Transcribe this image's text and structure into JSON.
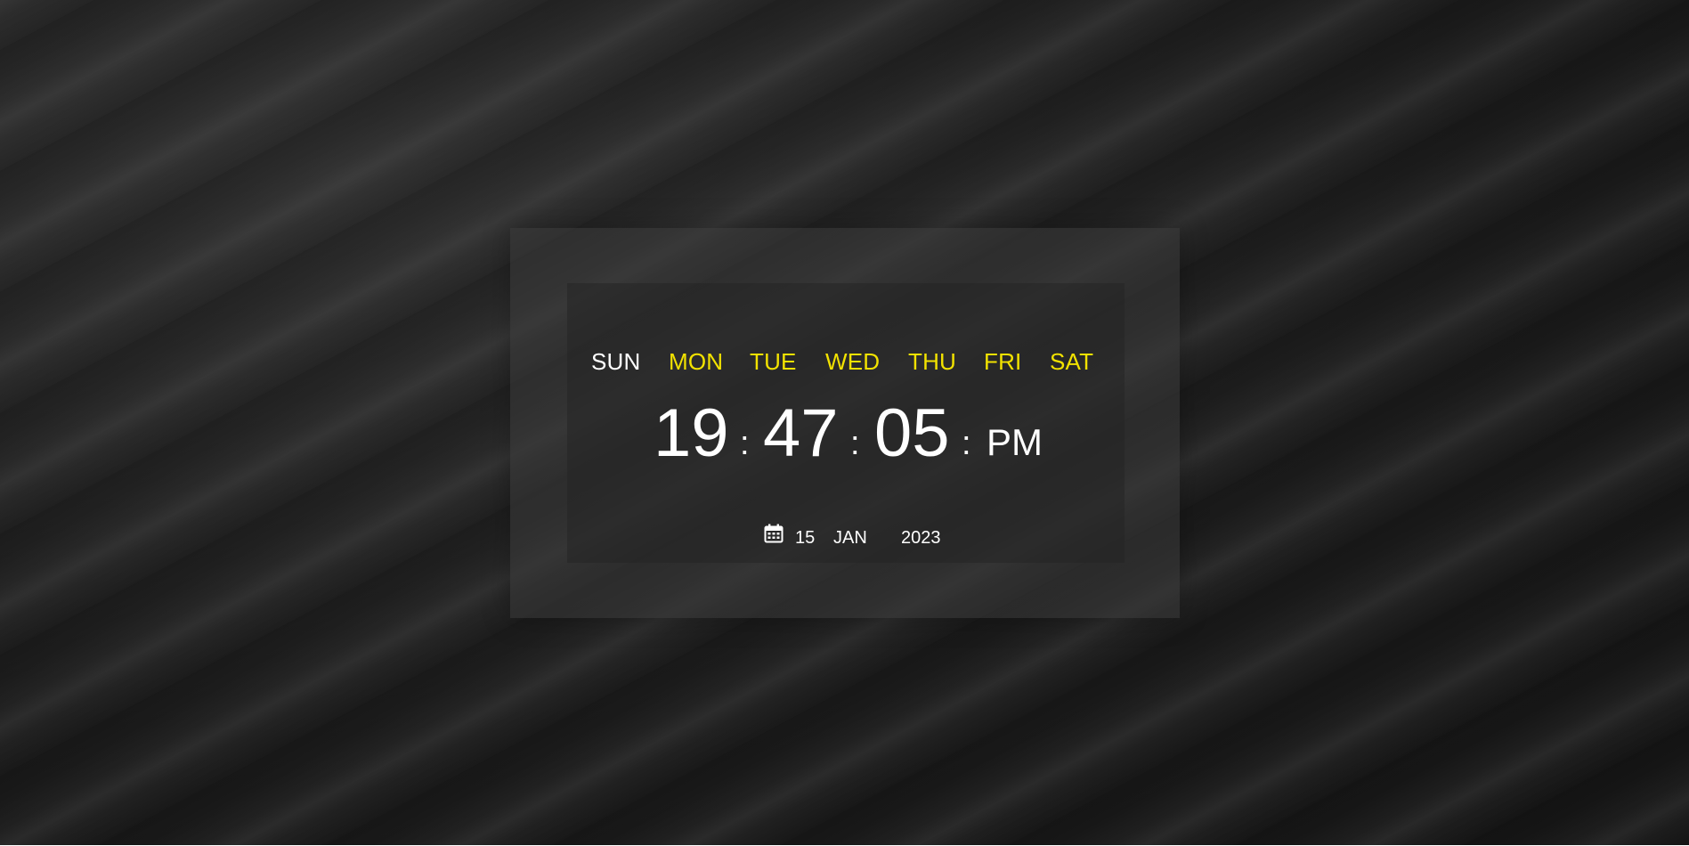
{
  "days": [
    {
      "label": "SUN",
      "active": true
    },
    {
      "label": "MON",
      "active": false
    },
    {
      "label": "TUE",
      "active": false
    },
    {
      "label": "WED",
      "active": false
    },
    {
      "label": "THU",
      "active": false
    },
    {
      "label": "FRI",
      "active": false
    },
    {
      "label": "SAT",
      "active": false
    }
  ],
  "time": {
    "hours": "19",
    "minutes": "47",
    "seconds": "05",
    "separator": ":",
    "ampm": "PM"
  },
  "date": {
    "icon": "calendar-icon",
    "day": "15",
    "month": "JAN",
    "year": "2023"
  },
  "colors": {
    "active_day": "#ffffff",
    "inactive_day": "#f2e200",
    "text": "#ffffff",
    "background": "#1b1b1b"
  }
}
